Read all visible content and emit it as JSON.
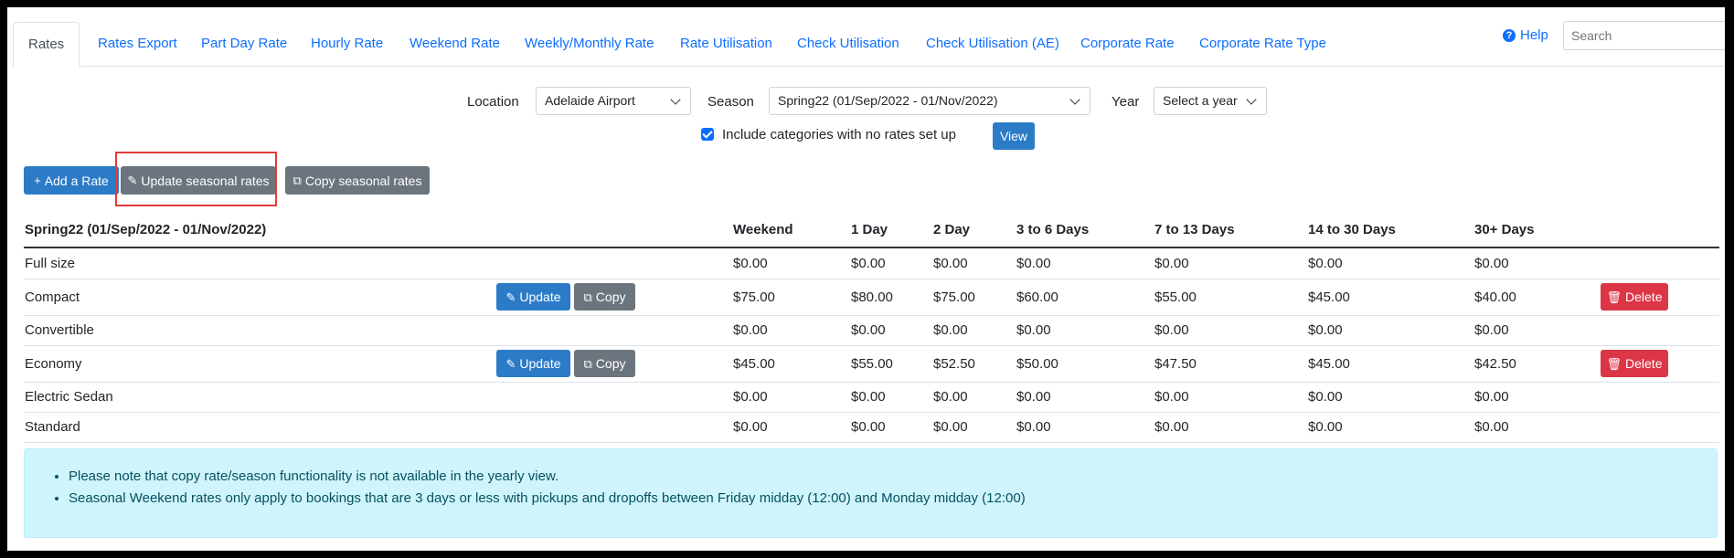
{
  "tabs": [
    {
      "label": "Rates"
    },
    {
      "label": "Rates Export"
    },
    {
      "label": "Part Day Rate"
    },
    {
      "label": "Hourly Rate"
    },
    {
      "label": "Weekend Rate"
    },
    {
      "label": "Weekly/Monthly Rate"
    },
    {
      "label": "Rate Utilisation"
    },
    {
      "label": "Check Utilisation"
    },
    {
      "label": "Check Utilisation (AE)"
    },
    {
      "label": "Corporate Rate"
    },
    {
      "label": "Corporate Rate Type"
    }
  ],
  "help": {
    "label": "Help",
    "icon": "question-circle-icon"
  },
  "search": {
    "placeholder": "Search"
  },
  "filters": {
    "location_label": "Location",
    "location_value": "Adelaide Airport",
    "season_label": "Season",
    "season_value": "Spring22 (01/Sep/2022 - 01/Nov/2022)",
    "year_label": "Year",
    "year_value": "Select a year",
    "include_label": "Include categories with no rates set up",
    "include_checked": true,
    "view_label": "View"
  },
  "actions": {
    "add_rate": "Add a Rate",
    "update_seasonal": "Update seasonal rates",
    "copy_seasonal": "Copy seasonal rates"
  },
  "table": {
    "title": "Spring22 (01/Sep/2022 - 01/Nov/2022)",
    "columns": [
      "Weekend",
      "1 Day",
      "2 Day",
      "3 to 6 Days",
      "7 to 13 Days",
      "14 to 30 Days",
      "30+ Days"
    ],
    "update_label": "Update",
    "copy_label": "Copy",
    "delete_label": "Delete",
    "rows": [
      {
        "name": "Full size",
        "values": [
          "$0.00",
          "$0.00",
          "$0.00",
          "$0.00",
          "$0.00",
          "$0.00",
          "$0.00"
        ],
        "actions": false
      },
      {
        "name": "Compact",
        "values": [
          "$75.00",
          "$80.00",
          "$75.00",
          "$60.00",
          "$55.00",
          "$45.00",
          "$40.00"
        ],
        "actions": true
      },
      {
        "name": "Convertible",
        "values": [
          "$0.00",
          "$0.00",
          "$0.00",
          "$0.00",
          "$0.00",
          "$0.00",
          "$0.00"
        ],
        "actions": false
      },
      {
        "name": "Economy",
        "values": [
          "$45.00",
          "$55.00",
          "$52.50",
          "$50.00",
          "$47.50",
          "$45.00",
          "$42.50"
        ],
        "actions": true
      },
      {
        "name": "Electric Sedan",
        "values": [
          "$0.00",
          "$0.00",
          "$0.00",
          "$0.00",
          "$0.00",
          "$0.00",
          "$0.00"
        ],
        "actions": false
      },
      {
        "name": "Standard",
        "values": [
          "$0.00",
          "$0.00",
          "$0.00",
          "$0.00",
          "$0.00",
          "$0.00",
          "$0.00"
        ],
        "actions": false
      }
    ]
  },
  "notes": [
    "Please note that copy rate/season functionality is not available in the yearly view.",
    "Seasonal Weekend rates only apply to bookings that are 3 days or less with pickups and dropoffs between Friday midday (12:00) and Monday midday (12:00)"
  ]
}
